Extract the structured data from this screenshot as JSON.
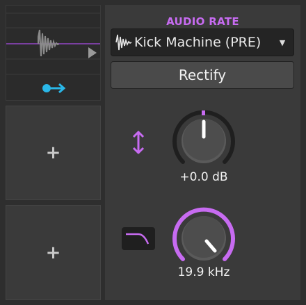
{
  "device": {
    "title": "AUDIO RATE",
    "preset": {
      "name": "Kick Machine (PRE)",
      "icon": "waveform-icon",
      "dropdown_icon": "caret-down-icon"
    },
    "action_button": {
      "label": "Rectify"
    }
  },
  "slots": [
    {
      "type": "preview",
      "icons": [
        "waveform-preview",
        "play-triangle-icon",
        "arrow-right-icon"
      ]
    },
    {
      "type": "empty",
      "add_glyph": "+"
    },
    {
      "type": "empty",
      "add_glyph": "+"
    }
  ],
  "controls": {
    "gain": {
      "value_text": "+0.0 dB",
      "level": 0.5,
      "icon": "vertical-arrows-icon"
    },
    "cutoff": {
      "value_text": "19.9 kHz",
      "level": 0.98,
      "icon": "low-pass-filter-icon"
    }
  },
  "colors": {
    "accent": "#c76bf1",
    "cyan": "#2ab7e8",
    "panel": "#3a3a3a",
    "background": "#2e2e2e"
  }
}
